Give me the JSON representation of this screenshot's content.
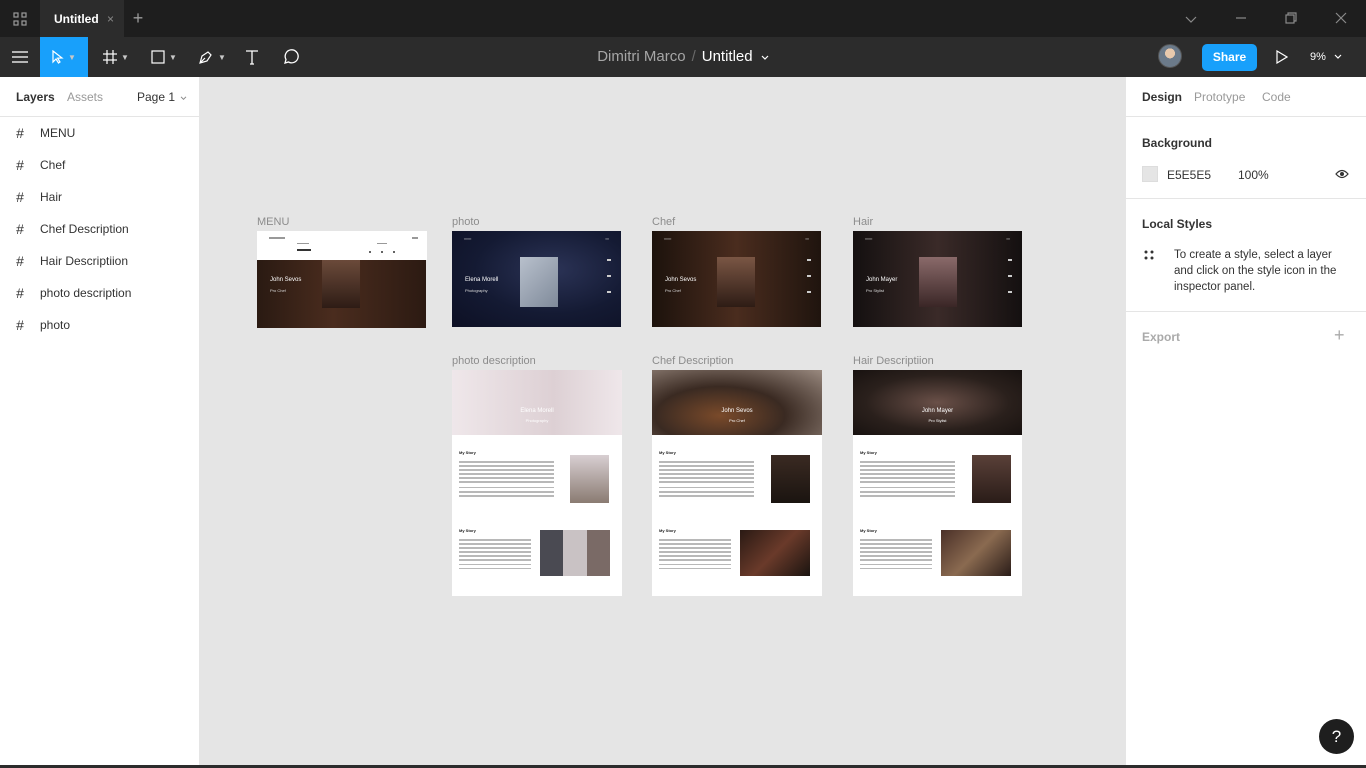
{
  "titlebar": {
    "tab_title": "Untitled",
    "tab_close": "×",
    "new_tab": "+",
    "colors": {
      "bg": "#1e1e1e",
      "tab_bg": "#2c2c2c"
    }
  },
  "toolbar": {
    "team_name": "Dimitri Marco",
    "separator": "/",
    "file_name": "Untitled",
    "share_label": "Share",
    "zoom": "9%",
    "accent": "#18a0fb"
  },
  "left_panel": {
    "tabs": [
      "Layers",
      "Assets"
    ],
    "page_selector": "Page 1",
    "layers": [
      {
        "name": "MENU"
      },
      {
        "name": "Chef"
      },
      {
        "name": "Hair"
      },
      {
        "name": "Chef Description"
      },
      {
        "name": "Hair Descriptiion"
      },
      {
        "name": "photo description"
      },
      {
        "name": "photo"
      }
    ]
  },
  "right_panel": {
    "tabs": [
      "Design",
      "Prototype",
      "Code"
    ],
    "background_title": "Background",
    "background_hex": "E5E5E5",
    "background_opacity": "100%",
    "local_styles_title": "Local Styles",
    "local_styles_text": "To create a style, select a layer and click on the style icon in the inspector panel.",
    "export_title": "Export",
    "export_add": "+"
  },
  "canvas": {
    "background": "#E5E5E5",
    "frames": [
      {
        "label": "MENU",
        "name": "John Sevos",
        "role": "Pro Chef"
      },
      {
        "label": "photo",
        "name": "Elena Morell",
        "role": "Photography"
      },
      {
        "label": "Chef",
        "name": "John Sevos",
        "role": "Pro Chef"
      },
      {
        "label": "Hair",
        "name": "John Mayer",
        "role": "Pro Stylist"
      },
      {
        "label": "photo description",
        "name": "Elena Morell",
        "role": "Photography"
      },
      {
        "label": "Chef Description",
        "name": "John Sevos",
        "role": "Pro Chef"
      },
      {
        "label": "Hair Descriptiion",
        "name": "John Mayer",
        "role": "Pro Stylist"
      }
    ],
    "story_heading": "My Story"
  },
  "help_button": "?"
}
